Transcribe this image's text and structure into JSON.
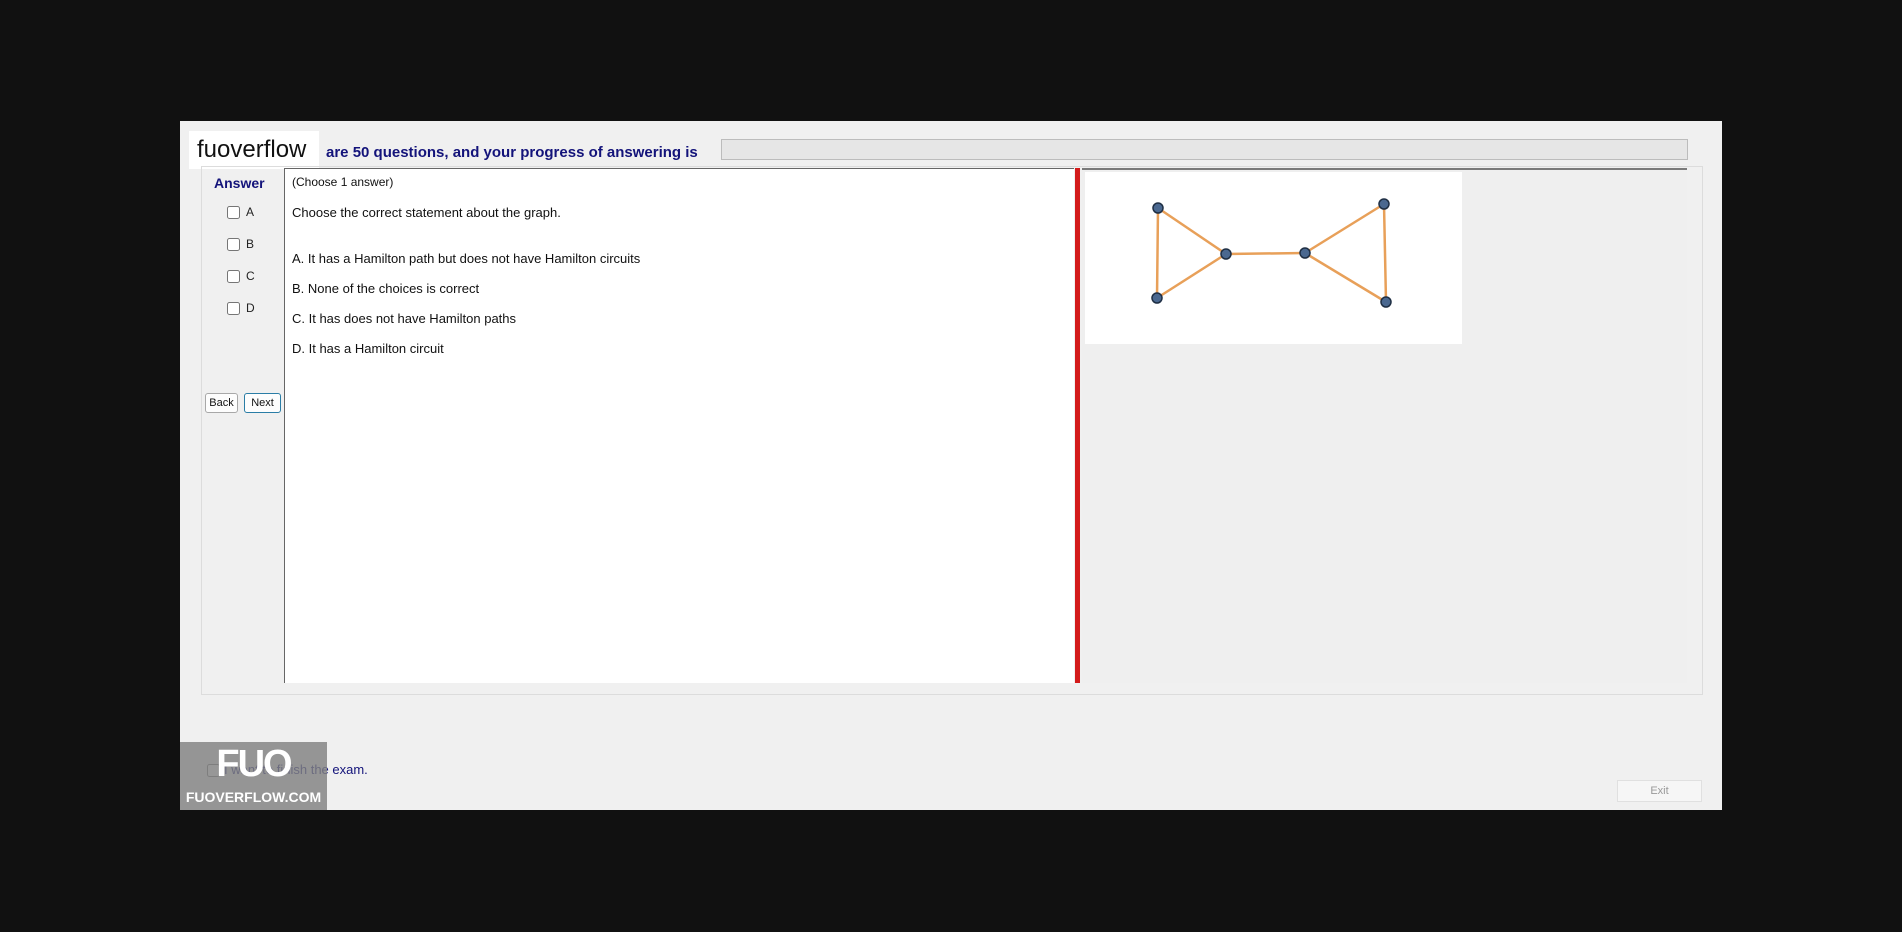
{
  "brand": "fuoverflow",
  "header": {
    "text": "are 50 questions, and your progress of answering is",
    "progress_percent": 0
  },
  "answer_panel": {
    "title": "Answer",
    "options": [
      "A",
      "B",
      "C",
      "D"
    ],
    "back_label": "Back",
    "next_label": "Next"
  },
  "question": {
    "instruction": "(Choose 1 answer)",
    "prompt": "Choose the correct statement about the graph.",
    "choices": [
      "A.  It has a Hamilton path but does not have Hamilton circuits",
      "B.  None of the choices is correct",
      "C.  It has does not have Hamilton paths",
      "D.  It has a Hamilton circuit"
    ]
  },
  "footer": {
    "finish_text": "I want to finish the exam.",
    "exit_label": "Exit"
  },
  "logo": {
    "mark": "FUO",
    "text": "FUOVERFLOW.COM"
  },
  "colors": {
    "header_text": "#13137a",
    "splitter": "#d31b1b",
    "graph_edge": "#e8a059",
    "graph_node": "#4a6890"
  }
}
